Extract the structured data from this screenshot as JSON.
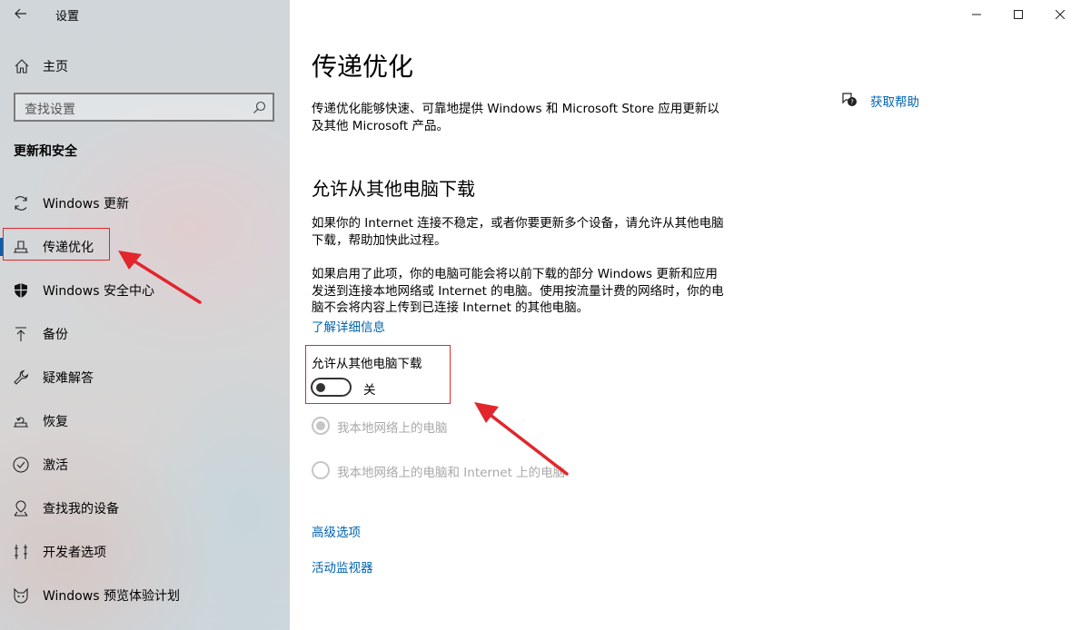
{
  "app": {
    "title": "设置"
  },
  "sidebar": {
    "home_label": "主页",
    "search_placeholder": "查找设置",
    "section_title": "更新和安全",
    "items": [
      {
        "label": "Windows 更新",
        "icon": "refresh-icon"
      },
      {
        "label": "传递优化",
        "icon": "delivery-optimization-icon",
        "selected": true
      },
      {
        "label": "Windows 安全中心",
        "icon": "shield-icon"
      },
      {
        "label": "备份",
        "icon": "backup-arrow-icon"
      },
      {
        "label": "疑难解答",
        "icon": "wrench-icon"
      },
      {
        "label": "恢复",
        "icon": "recovery-icon"
      },
      {
        "label": "激活",
        "icon": "check-circle-icon"
      },
      {
        "label": "查找我的设备",
        "icon": "find-device-icon"
      },
      {
        "label": "开发者选项",
        "icon": "developer-icon"
      },
      {
        "label": "Windows 预览体验计划",
        "icon": "insider-icon"
      }
    ]
  },
  "main": {
    "title": "传递优化",
    "intro": "传递优化能够快速、可靠地提供 Windows 和 Microsoft Store 应用更新以及其他 Microsoft 产品。",
    "help_label": "获取帮助",
    "subtitle": "允许从其他电脑下载",
    "para1": "如果你的 Internet 连接不稳定，或者你要更新多个设备，请允许从其他电脑下载，帮助加快此过程。",
    "para2": "如果启用了此项，你的电脑可能会将以前下载的部分 Windows 更新和应用发送到连接本地网络或 Internet 的电脑。使用按流量计费的网络时，你的电脑不会将内容上传到已连接 Internet 的其他电脑。",
    "learn_more": "了解详细信息",
    "toggle_label": "允许从其他电脑下载",
    "toggle_state": "关",
    "toggle_on": false,
    "radio_options": [
      {
        "label": "我本地网络上的电脑",
        "checked": true,
        "disabled": true
      },
      {
        "label": "我本地网络上的电脑和 Internet 上的电脑",
        "checked": false,
        "disabled": true
      }
    ],
    "advanced_link": "高级选项",
    "monitor_link": "活动监视器"
  },
  "colors": {
    "accent": "#0063b1",
    "annotation": "#e2262c"
  }
}
